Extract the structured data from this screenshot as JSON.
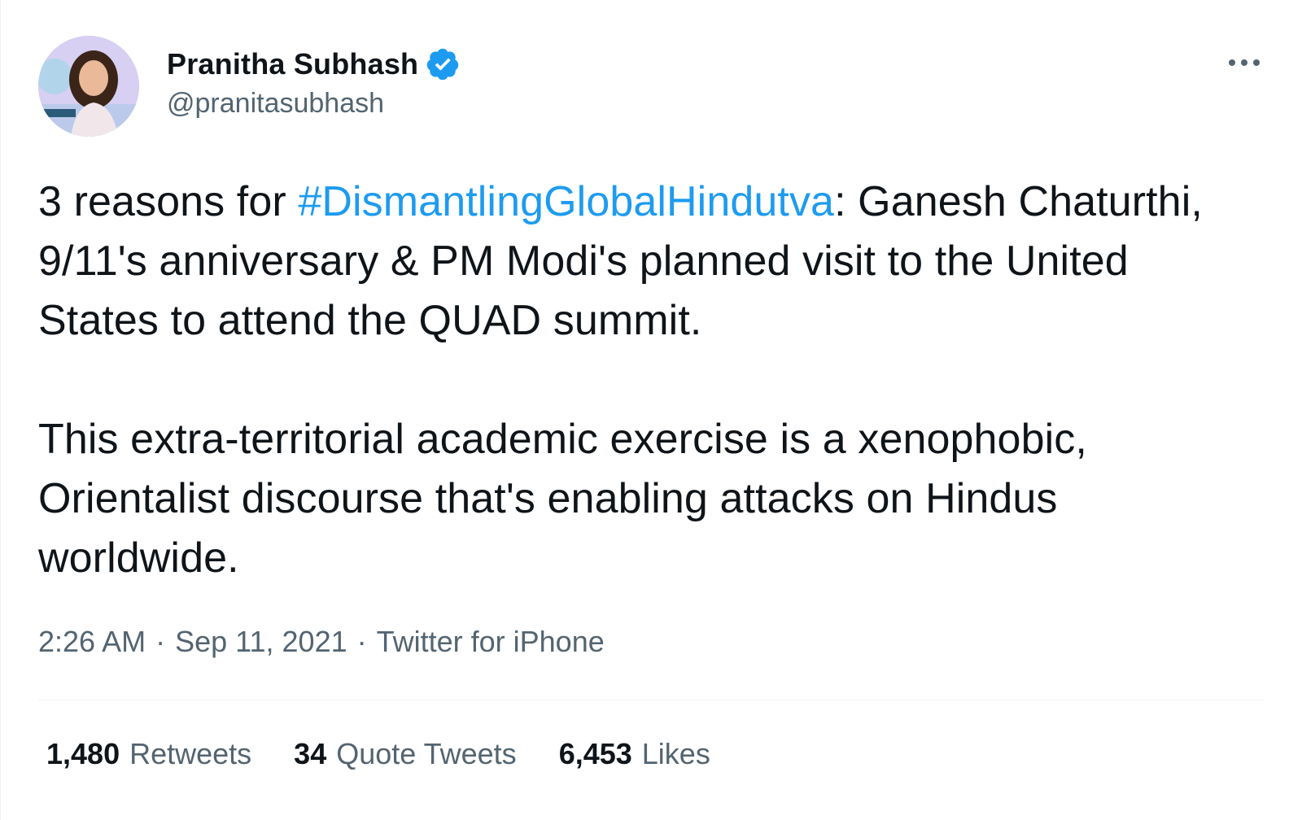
{
  "tweet": {
    "author": {
      "display_name": "Pranitha Subhash",
      "handle": "@pranitasubhash",
      "verified": true
    },
    "body": {
      "paragraph1_prefix": "3 reasons for ",
      "hashtag": "#DismantlingGlobalHindutva",
      "paragraph1_suffix": ": Ganesh Chaturthi, 9/11's anniversary & PM Modi's planned visit to the United States to attend the QUAD summit.",
      "paragraph2": "This extra-territorial academic exercise is a xenophobic, Orientalist discourse that's enabling attacks on Hindus worldwide."
    },
    "meta": {
      "time": "2:26 AM",
      "separator": "·",
      "date": "Sep 11, 2021",
      "source": "Twitter for iPhone"
    },
    "stats": {
      "retweets_count": "1,480",
      "retweets_label": "Retweets",
      "quotes_count": "34",
      "quotes_label": "Quote Tweets",
      "likes_count": "6,453",
      "likes_label": "Likes"
    }
  },
  "colors": {
    "link": "#1d9bf0",
    "secondary_text": "#536471",
    "primary_text": "#0f1419",
    "verified_badge": "#1d9bf0"
  },
  "icons": {
    "verified": "verified-badge-icon",
    "more": "more-options-icon"
  }
}
